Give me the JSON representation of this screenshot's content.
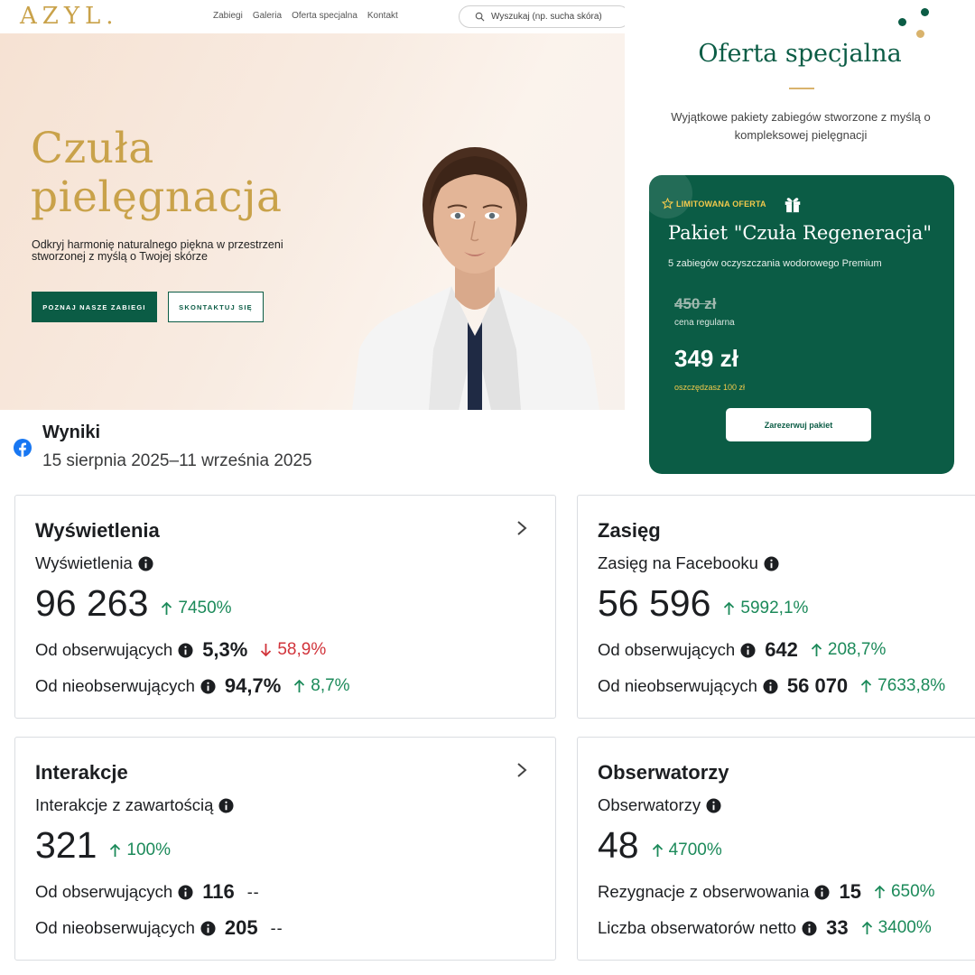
{
  "website": {
    "logo": "AZYL.",
    "nav": [
      "Zabiegi",
      "Galeria",
      "Oferta specjalna",
      "Kontakt"
    ],
    "search_placeholder": "Wyszukaj (np. sucha skóra)",
    "hero": {
      "title_line1": "Czuła",
      "title_line2": "pielęgnacja",
      "subtitle": "Odkryj harmonię naturalnego piękna w przestrzeni stworzonej z myślą o Twojej skórze",
      "primary_button": "POZNAJ NASZE ZABIEGI",
      "secondary_button": "SKONTAKTUJ SIĘ"
    }
  },
  "offer": {
    "title": "Oferta specjalna",
    "description": "Wyjątkowe pakiety zabiegów stworzone z myślą o kompleksowej pielęgnacji",
    "card": {
      "badge": "LIMITOWANA OFERTA",
      "title": "Pakiet \"Czuła Regeneracja\"",
      "subtitle": "5 zabiegów oczyszczania wodorowego Premium",
      "old_price": "450 zł",
      "regular_label": "cena regularna",
      "new_price": "349 zł",
      "savings": "oszczędzasz 100 zł",
      "button": "Zarezerwuj pakiet"
    },
    "colors": {
      "brand_green": "#0b5c45",
      "gold": "#c9a24a"
    }
  },
  "insights": {
    "title": "Wyniki",
    "date_range": "15 sierpnia 2025–11 września 2025",
    "views": {
      "title": "Wyświetlenia",
      "label": "Wyświetlenia",
      "value": "96 263",
      "change": "7450%",
      "followers_label": "Od obserwujących",
      "followers_value": "5,3%",
      "followers_change": "58,9%",
      "nonfollowers_label": "Od nieobserwujących",
      "nonfollowers_value": "94,7%",
      "nonfollowers_change": "8,7%"
    },
    "reach": {
      "title": "Zasięg",
      "label": "Zasięg na Facebooku",
      "value": "56 596",
      "change": "5992,1%",
      "followers_label": "Od obserwujących",
      "followers_value": "642",
      "followers_change": "208,7%",
      "nonfollowers_label": "Od nieobserwujących",
      "nonfollowers_value": "56 070",
      "nonfollowers_change": "7633,8%"
    },
    "interactions": {
      "title": "Interakcje",
      "label": "Interakcje z zawartością",
      "value": "321",
      "change": "100%",
      "followers_label": "Od obserwujących",
      "followers_value": "116",
      "followers_change": "--",
      "nonfollowers_label": "Od nieobserwujących",
      "nonfollowers_value": "205",
      "nonfollowers_change": "--"
    },
    "followers": {
      "title": "Obserwatorzy",
      "label": "Obserwatorzy",
      "value": "48",
      "change": "4700%",
      "unfollows_label": "Rezygnacje z obserwowania",
      "unfollows_value": "15",
      "unfollows_change": "650%",
      "net_label": "Liczba obserwatorów netto",
      "net_value": "33",
      "net_change": "3400%"
    },
    "colors": {
      "up": "#1c8a5a",
      "down": "#d1343b",
      "facebook": "#1877f2"
    }
  }
}
